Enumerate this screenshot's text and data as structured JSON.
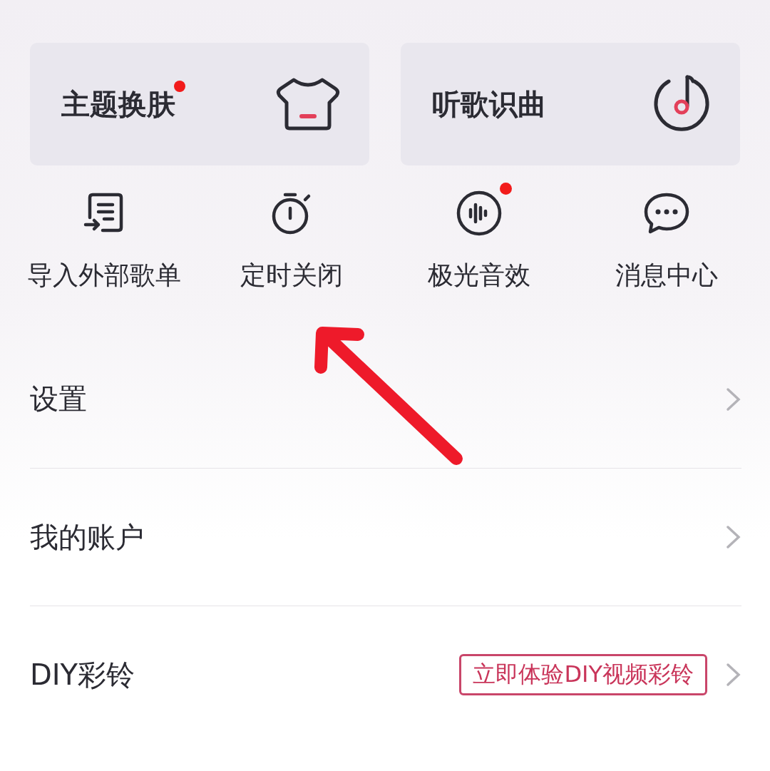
{
  "feature_cards": [
    {
      "label": "主题换肤",
      "badge": true
    },
    {
      "label": "听歌识曲",
      "badge": false
    }
  ],
  "shortcuts": [
    {
      "label": "导入外部歌单",
      "badge": false
    },
    {
      "label": "定时关闭",
      "badge": false
    },
    {
      "label": "极光音效",
      "badge": true
    },
    {
      "label": "消息中心",
      "badge": false
    }
  ],
  "menu": [
    {
      "label": "设置"
    },
    {
      "label": "我的账户"
    },
    {
      "label": "DIY彩铃",
      "promo": "立即体验DIY视频彩铃"
    }
  ],
  "annotation": {
    "kind": "arrow"
  }
}
